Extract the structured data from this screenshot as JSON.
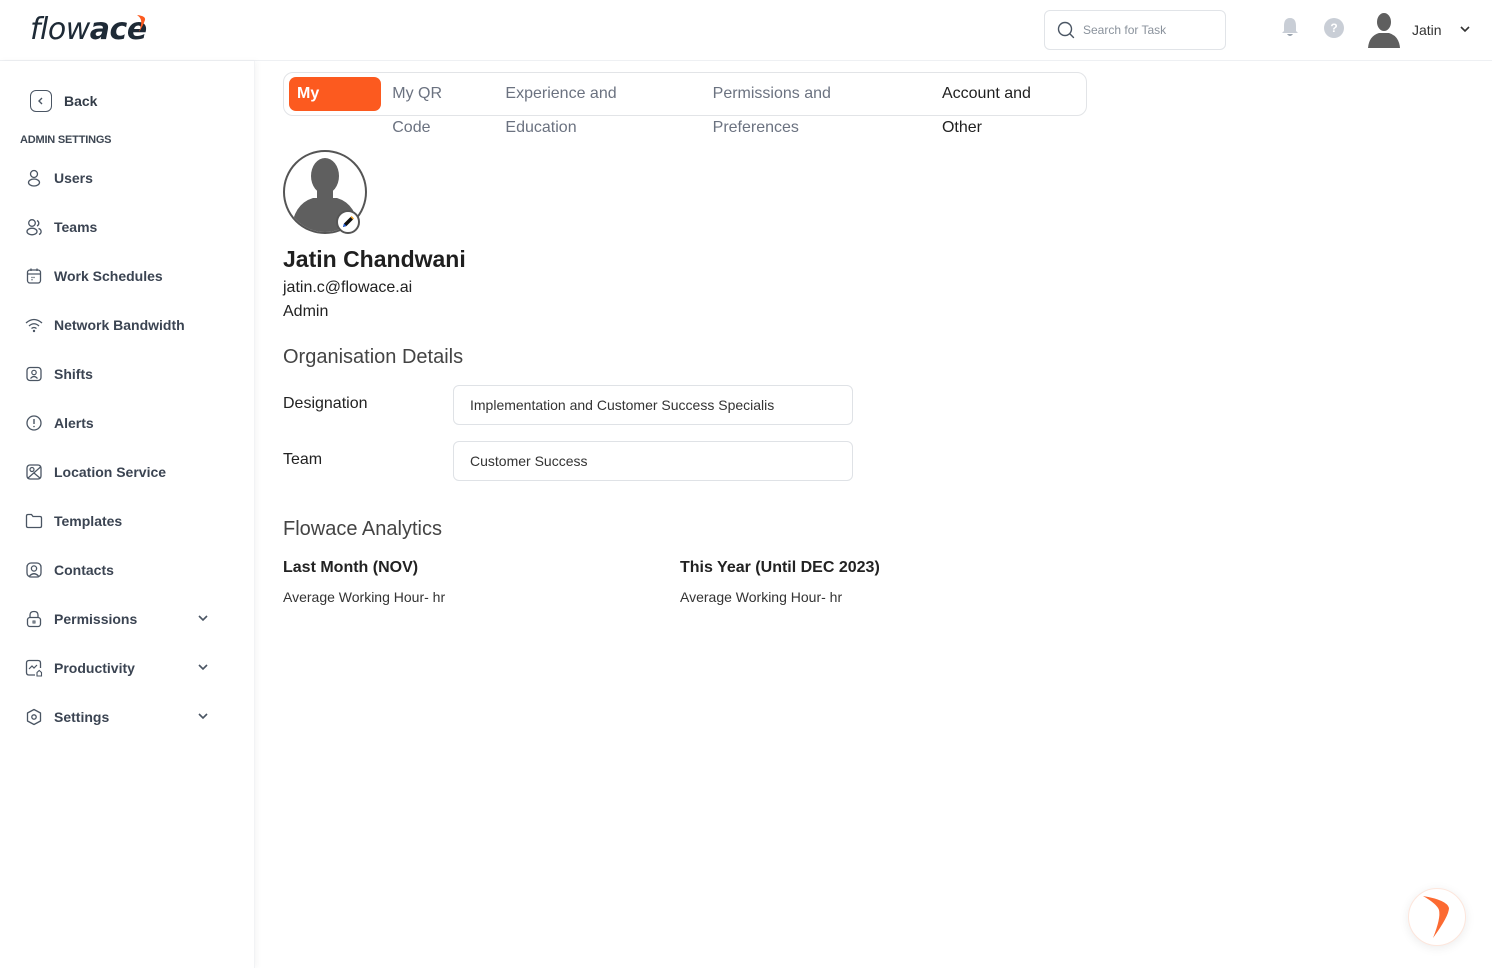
{
  "app": {
    "logo_text_light": "flow",
    "logo_text_bold": "ace",
    "brand_color": "#fc5a1f"
  },
  "header": {
    "search": {
      "placeholder": "Search for Task",
      "value": "",
      "icon": "search-icon"
    },
    "notification_icon": "bell-icon",
    "help_icon": "help-icon",
    "help_glyph": "?",
    "user": {
      "name": "Jatin",
      "avatar_icon": "user-avatar-icon",
      "menu_icon": "chevron-down-icon"
    }
  },
  "sidebar": {
    "back_label": "Back",
    "section_heading": "ADMIN SETTINGS",
    "items": [
      {
        "label": "Users",
        "icon": "user-icon",
        "expandable": false
      },
      {
        "label": "Teams",
        "icon": "teams-icon",
        "expandable": false
      },
      {
        "label": "Work Schedules",
        "icon": "calendar-icon",
        "expandable": false
      },
      {
        "label": "Network Bandwidth",
        "icon": "wifi-icon",
        "expandable": false
      },
      {
        "label": "Shifts",
        "icon": "shift-badge-icon",
        "expandable": false
      },
      {
        "label": "Alerts",
        "icon": "alert-icon",
        "expandable": false
      },
      {
        "label": "Location Service",
        "icon": "location-map-icon",
        "expandable": false
      },
      {
        "label": "Templates",
        "icon": "folder-icon",
        "expandable": false
      },
      {
        "label": "Contacts",
        "icon": "contact-icon",
        "expandable": false
      },
      {
        "label": "Permissions",
        "icon": "lock-icon",
        "expandable": true
      },
      {
        "label": "Productivity",
        "icon": "productivity-chart-icon",
        "expandable": true
      },
      {
        "label": "Settings",
        "icon": "settings-hexagon-icon",
        "expandable": true
      }
    ]
  },
  "tabs": [
    {
      "label": "My Profile",
      "active": true
    },
    {
      "label": "My QR Code",
      "active": false
    },
    {
      "label": "Experience and Education",
      "active": false
    },
    {
      "label": "Permissions and Preferences",
      "active": false
    },
    {
      "label": "Account and Other",
      "active": false
    }
  ],
  "profile": {
    "name": "Jatin Chandwani",
    "email": "jatin.c@flowace.ai",
    "role": "Admin",
    "edit_icon": "pencil-icon"
  },
  "organisation": {
    "title": "Organisation Details",
    "fields": [
      {
        "label": "Designation",
        "value": "Implementation and Customer Success Specialis"
      },
      {
        "label": "Team",
        "value": "Customer Success"
      }
    ]
  },
  "analytics": {
    "title": "Flowace Analytics",
    "stats": [
      {
        "title": "Last Month (NOV)",
        "subtitle": "Average Working Hour- hr"
      },
      {
        "title": "This Year (Until DEC 2023)",
        "subtitle": "Average Working Hour- hr"
      }
    ]
  },
  "fab": {
    "icon": "flowace-assistant-icon"
  }
}
